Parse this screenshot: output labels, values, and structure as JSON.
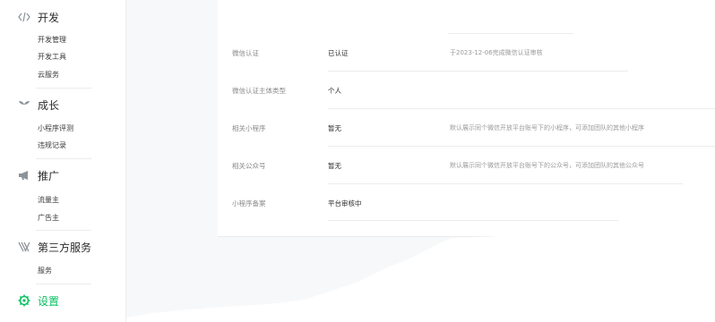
{
  "sidebar": {
    "groups": [
      {
        "label": "开发",
        "icon": "code-icon",
        "items": [
          "开发管理",
          "开发工具",
          "云服务"
        ]
      },
      {
        "label": "成长",
        "icon": "sprout-icon",
        "items": [
          "小程序评测",
          "违规记录"
        ]
      },
      {
        "label": "推广",
        "icon": "megaphone-icon",
        "items": [
          "流量主",
          "广告主"
        ]
      },
      {
        "label": "第三方服务",
        "icon": "network-icon",
        "items": [
          "服务"
        ]
      },
      {
        "label": "设置",
        "icon": "gear-icon",
        "items": []
      }
    ],
    "active_color": "#07c160"
  },
  "info": {
    "rows": [
      {
        "label": "微信认证",
        "value": "已认证",
        "desc": "于2023-12-06完成微信认证审核"
      },
      {
        "label": "微信认证主体类型",
        "value": "个人",
        "desc": ""
      },
      {
        "label": "相关小程序",
        "value": "暂无",
        "desc": "默认展示同个微信开放平台账号下的小程序，可添加团队的其他小程序"
      },
      {
        "label": "相关公众号",
        "value": "暂无",
        "desc": "默认展示同个微信开放平台账号下的公众号，可添加团队的其他公众号"
      },
      {
        "label": "小程序备案",
        "value": "平台审核中",
        "desc": ""
      }
    ]
  }
}
